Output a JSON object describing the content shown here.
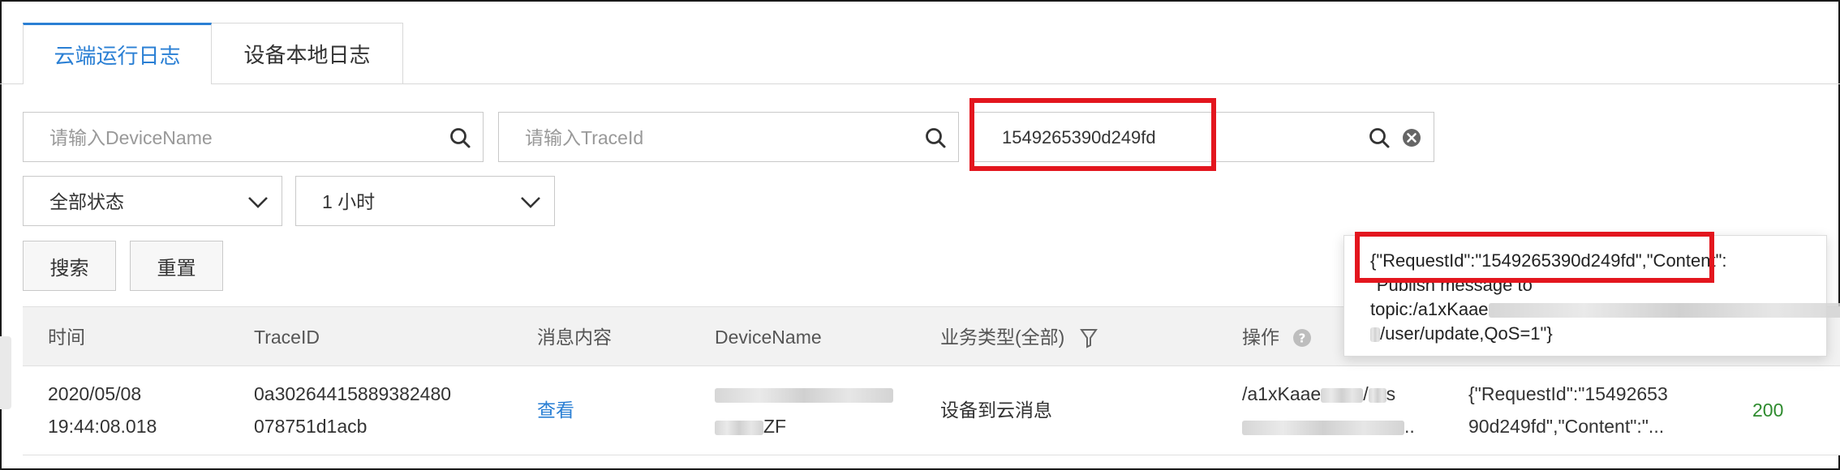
{
  "tabs": [
    {
      "label": "云端运行日志",
      "active": true
    },
    {
      "label": "设备本地日志",
      "active": false
    }
  ],
  "filters": {
    "device_name_placeholder": "请输入DeviceName",
    "trace_id_placeholder": "请输入TraceId",
    "message_id_value": "1549265390d249fd",
    "status_select": "全部状态",
    "time_select": "1 小时",
    "search_button": "搜索",
    "reset_button": "重置"
  },
  "table": {
    "headers": {
      "time": "时间",
      "trace_id": "TraceID",
      "message": "消息内容",
      "device_name": "DeviceName",
      "business_type": "业务类型(全部)",
      "operation": "操作"
    },
    "row": {
      "time_line1": "2020/05/08",
      "time_line2": "19:44:08.018",
      "trace_line1": "0a30264415889382480",
      "trace_line2": "078751d1acb",
      "message_link": "查看",
      "device_tail": "ZF",
      "business_type": "设备到云消息",
      "operation_line1_a": "/a1xKaae",
      "operation_line1_b": "/",
      "operation_line1_c": "s",
      "operation_line2_tail": "..",
      "content_line1": "{\"RequestId\":\"15492653",
      "content_line2": "90d249fd\",\"Content\":\"...",
      "status_code": "200"
    }
  },
  "tooltip": {
    "line1": "{\"RequestId\":\"1549265390d249fd\",\"Content\":",
    "line2": "\"Publish message to",
    "line3": "topic:/a1xKaae",
    "line4": "/user/update,QoS=1\"}"
  },
  "colors": {
    "accent": "#2a7fd4",
    "highlight": "#e3161e",
    "success": "#2e8b2e"
  }
}
